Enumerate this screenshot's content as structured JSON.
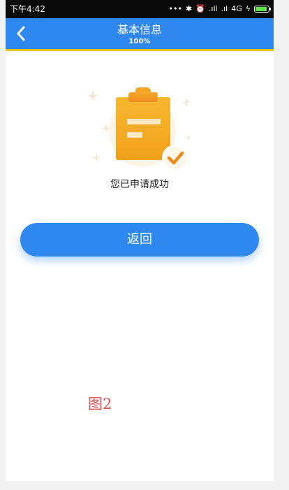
{
  "statusbar": {
    "time": "下午4:42",
    "icons": [
      "more-dots-icon",
      "bluetooth-icon",
      "alarm-icon",
      "signal-icon",
      "signal-icon-2",
      "battery-charging-icon"
    ],
    "network": "4G",
    "battery_color": "#5fe34a"
  },
  "navbar": {
    "back_icon": "chevron-left-icon",
    "title": "基本信息",
    "subtitle": "100%",
    "background": "#2f88f0",
    "underline_color": "#f4c21b"
  },
  "result": {
    "illustration_icon": "clipboard-check-icon",
    "message": "您已申请成功"
  },
  "actions": {
    "return_label": "返回"
  },
  "caption": "图2"
}
